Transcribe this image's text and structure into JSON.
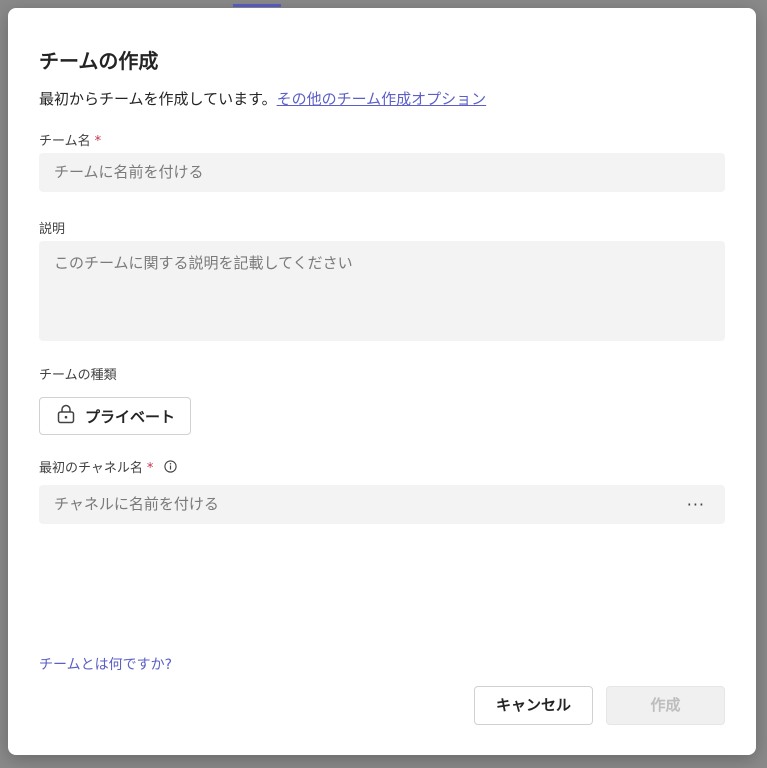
{
  "dialog": {
    "title": "チームの作成",
    "subtitle_text": "最初からチームを作成しています。",
    "subtitle_link": "その他のチーム作成オプション"
  },
  "team_name": {
    "label": "チーム名",
    "required_mark": "*",
    "placeholder": "チームに名前を付ける"
  },
  "description": {
    "label": "説明",
    "placeholder": "このチームに関する説明を記載してください"
  },
  "team_type": {
    "label": "チームの種類",
    "value": "プライベート",
    "icon": "lock-icon"
  },
  "first_channel": {
    "label": "最初のチャネル名",
    "required_mark": "*",
    "info_icon": "info-icon",
    "placeholder": "チャネルに名前を付ける",
    "more_label": "···"
  },
  "help_link": "チームとは何ですか?",
  "buttons": {
    "cancel": "キャンセル",
    "create": "作成"
  },
  "colors": {
    "accent": "#5b5fc7",
    "required": "#c4314b",
    "field_bg": "#f3f3f3"
  }
}
